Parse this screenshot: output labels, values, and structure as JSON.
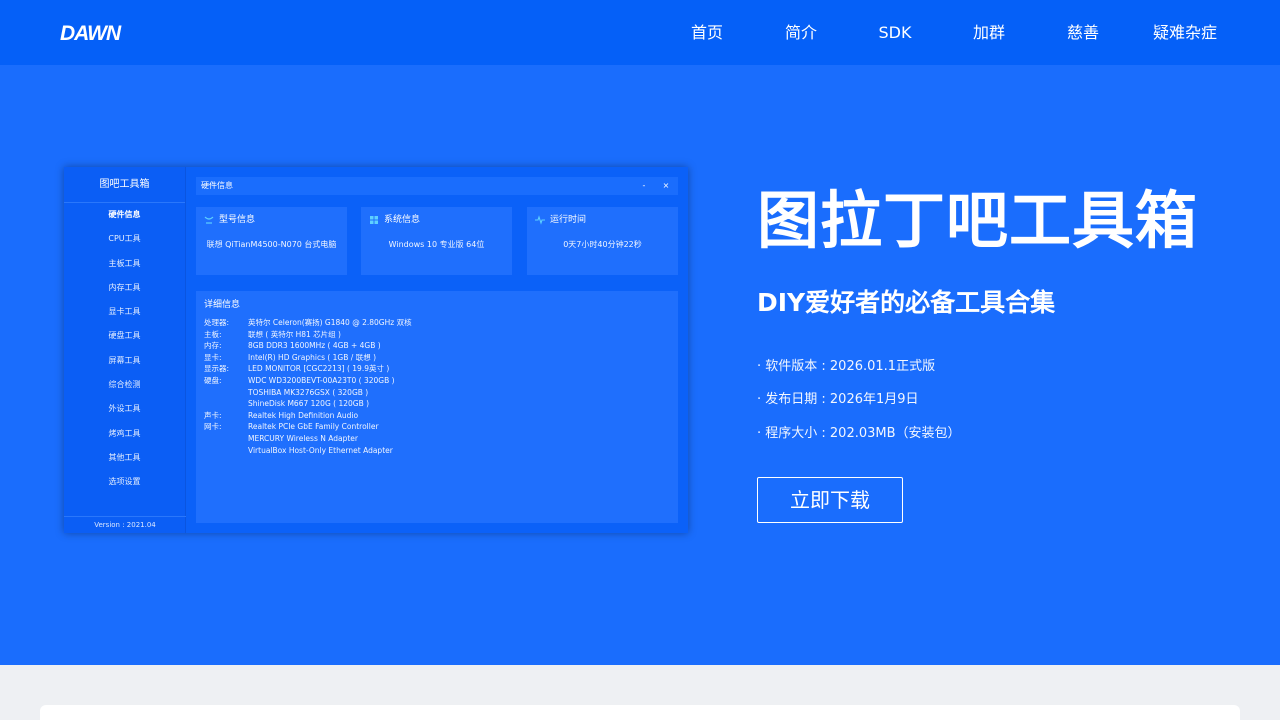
{
  "header": {
    "logo_text": "DAWN",
    "nav": [
      {
        "label": "首页"
      },
      {
        "label": "简介"
      },
      {
        "label": "SDK"
      },
      {
        "label": "加群"
      },
      {
        "label": "慈善"
      },
      {
        "label": "疑难杂症"
      }
    ]
  },
  "app": {
    "sidebar_title": "图吧工具箱",
    "sidebar_items": [
      {
        "label": "硬件信息"
      },
      {
        "label": "CPU工具"
      },
      {
        "label": "主板工具"
      },
      {
        "label": "内存工具"
      },
      {
        "label": "显卡工具"
      },
      {
        "label": "硬盘工具"
      },
      {
        "label": "屏幕工具"
      },
      {
        "label": "综合检测"
      },
      {
        "label": "外设工具"
      },
      {
        "label": "烤鸡工具"
      },
      {
        "label": "其他工具"
      },
      {
        "label": "选项设置"
      }
    ],
    "version": "Version : 2021.04",
    "window_title": "硬件信息",
    "min_label": "-",
    "close_label": "×",
    "cards": [
      {
        "title": "型号信息",
        "value": "联想 QiTianM4500-N070 台式电脑",
        "icon": "monitor-icon"
      },
      {
        "title": "系统信息",
        "value": "Windows 10 专业版 64位",
        "icon": "windows-icon"
      },
      {
        "title": "运行时间",
        "value": "0天7小时40分钟22秒",
        "icon": "pulse-icon"
      }
    ],
    "detail_title": "详细信息",
    "detail_rows": [
      {
        "key": "处理器:",
        "value": "英特尔 Celeron(赛扬) G1840 @ 2.80GHz 双核"
      },
      {
        "key": "主板:",
        "value": "联想 ( 英特尔 H81 芯片组 )"
      },
      {
        "key": "内存:",
        "value": "8GB DDR3 1600MHz ( 4GB + 4GB )"
      },
      {
        "key": "显卡:",
        "value": "Intel(R) HD Graphics ( 1GB / 联想 )"
      },
      {
        "key": "显示器:",
        "value": "LED MONITOR [CGC2213] ( 19.9英寸 )"
      },
      {
        "key": "硬盘:",
        "value": "WDC WD3200BEVT-00A23T0 ( 320GB )"
      },
      {
        "key": "",
        "value": "TOSHIBA MK3276GSX ( 320GB )"
      },
      {
        "key": "",
        "value": "ShineDisk M667 120G ( 120GB )"
      },
      {
        "key": "声卡:",
        "value": "Realtek High Definition Audio"
      },
      {
        "key": "网卡:",
        "value": "Realtek PCIe GbE Family Controller"
      },
      {
        "key": "",
        "value": "MERCURY Wireless N Adapter"
      },
      {
        "key": "",
        "value": "VirtualBox Host-Only Ethernet Adapter"
      }
    ]
  },
  "hero": {
    "title": "图拉丁吧工具箱",
    "subtitle": "DIY爱好者的必备工具合集",
    "info": [
      "· 软件版本 : 2026.01.1正式版",
      "· 发布日期 : 2026年1月9日",
      "· 程序大小 : 202.03MB（安装包）"
    ],
    "download_label": "立即下载"
  },
  "colors": {
    "nav_bg": "#0560f8",
    "hero_bg": "#1a6dfd",
    "page_bg": "#eef0f3"
  }
}
